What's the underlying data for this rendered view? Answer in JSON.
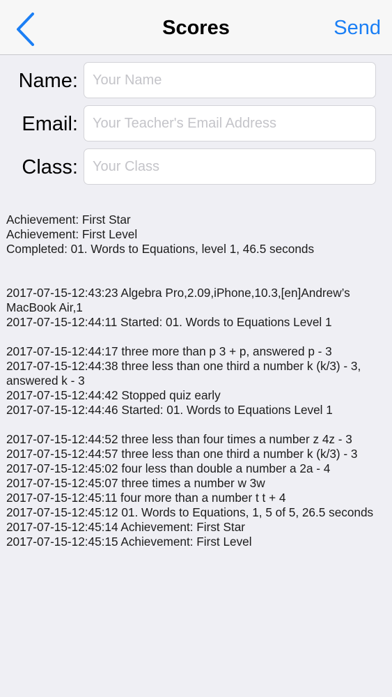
{
  "navbar": {
    "title": "Scores",
    "send_label": "Send"
  },
  "icons": {
    "back": "chevron-left-icon"
  },
  "colors": {
    "accent": "#1b7ff5",
    "background": "#efeff4",
    "navbar": "#f7f7f7"
  },
  "form": {
    "name": {
      "label": "Name:",
      "placeholder": "Your Name",
      "value": ""
    },
    "email": {
      "label": "Email:",
      "placeholder": "Your Teacher's Email Address",
      "value": ""
    },
    "class": {
      "label": "Class:",
      "placeholder": "Your Class",
      "value": ""
    }
  },
  "summary": [
    "Achievement: First Star",
    "Achievement: First Level",
    "Completed: 01. Words to Equations, level 1, 46.5 seconds"
  ],
  "log": {
    "session": [
      "2017-07-15-12:43:23 Algebra Pro,2.09,iPhone,10.3,[en]Andrew’s MacBook Air,1",
      "2017-07-15-12:44:11 Started: 01. Words to Equations  Level 1"
    ],
    "attempt1": [
      "2017-07-15-12:44:17 three more than p 3 + p, answered p - 3",
      "2017-07-15-12:44:38 three less than one third a number k (k/3) - 3, answered k - 3",
      "2017-07-15-12:44:42 Stopped quiz early",
      "2017-07-15-12:44:46 Started: 01. Words to Equations  Level 1"
    ],
    "attempt2": [
      "2017-07-15-12:44:52 three less than four times a number z 4z - 3",
      "2017-07-15-12:44:57 three less than one third a number k (k/3) - 3",
      "2017-07-15-12:45:02 four less than double a number a 2a - 4",
      "2017-07-15-12:45:07 three times a number w 3w",
      "2017-07-15-12:45:11 four more than a number t t + 4",
      "2017-07-15-12:45:12 01. Words to Equations, 1, 5 of 5, 26.5 seconds",
      "2017-07-15-12:45:14 Achievement: First Star",
      "2017-07-15-12:45:15 Achievement: First Level"
    ]
  }
}
